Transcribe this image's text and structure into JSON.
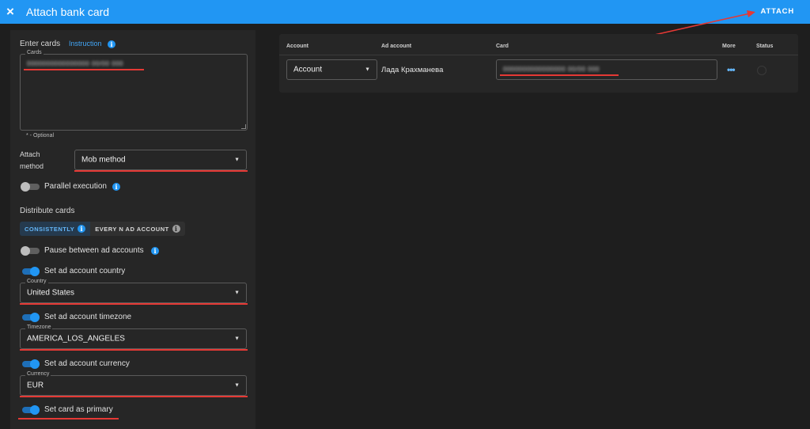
{
  "topbar": {
    "title": "Attach bank card",
    "close_icon": "×",
    "attach_label": "ATTACH",
    "color": "#2196f3"
  },
  "enter_cards": {
    "heading": "Enter cards",
    "instruction_link": "Instruction",
    "cards_label": "Cards",
    "cards_value": "0000000000000000 00/00 000",
    "optional_note": "* - Optional"
  },
  "attach_method": {
    "label_line1": "Attach",
    "label_line2": "method",
    "value": "Mob method"
  },
  "parallel_execution": {
    "label": "Parallel execution",
    "on": false
  },
  "distribute": {
    "heading": "Distribute cards",
    "options": [
      "CONSISTENTLY",
      "EVERY N AD ACCOUNT"
    ],
    "selected": "CONSISTENTLY"
  },
  "pause_between": {
    "label": "Pause between ad accounts",
    "on": false
  },
  "country": {
    "toggle_label": "Set ad account country",
    "on": true,
    "field_label": "Country",
    "value": "United States"
  },
  "timezone": {
    "toggle_label": "Set ad account timezone",
    "on": true,
    "field_label": "Timezone",
    "value": "AMERICA_LOS_ANGELES"
  },
  "currency": {
    "toggle_label": "Set ad account currency",
    "on": true,
    "field_label": "Currency",
    "value": "EUR"
  },
  "primary": {
    "toggle_label": "Set card as primary",
    "on": true
  },
  "table": {
    "columns": [
      "Account",
      "Ad account",
      "Card",
      "More",
      "Status"
    ],
    "rows": [
      {
        "account": "Account",
        "ad_account": "Лада Крахманева",
        "card": "0000000000000000 00/00 000",
        "more": "•••"
      }
    ]
  },
  "accent_colors": {
    "annotation_red": "#e53935",
    "toggle_on": "#2196f3"
  }
}
